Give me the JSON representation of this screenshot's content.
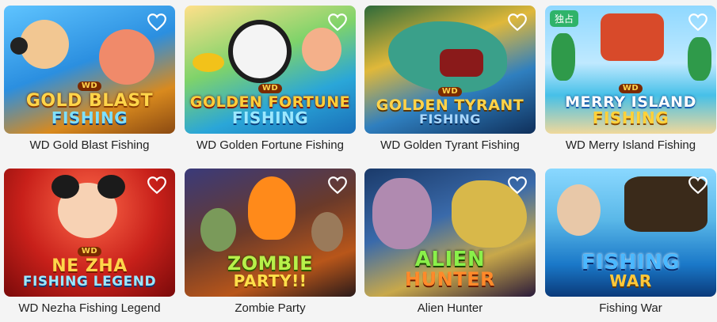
{
  "games": [
    {
      "title": "WD Gold Blast Fishing",
      "logo_line1": "GOLD BLAST",
      "logo_line2": "FISHING",
      "badge": "WD"
    },
    {
      "title": "WD Golden Fortune Fishing",
      "logo_line1": "GOLDEN FORTUNE",
      "logo_line2": "FISHING",
      "badge": "WD"
    },
    {
      "title": "WD Golden Tyrant Fishing",
      "logo_line1": "GOLDEN TYRANT",
      "logo_line2": "FISHING",
      "badge": "WD"
    },
    {
      "title": "WD Merry Island Fishing",
      "logo_line1": "MERRY ISLAND",
      "logo_line2": "FISHING",
      "badge": "WD",
      "tag": "独占"
    },
    {
      "title": "WD Nezha Fishing Legend",
      "logo_line1": "NE ZHA",
      "logo_line2": "FISHING LEGEND",
      "badge": "WD"
    },
    {
      "title": "Zombie Party",
      "logo_line1": "ZOMBIE",
      "logo_line2": "PARTY!!"
    },
    {
      "title": "Alien Hunter",
      "logo_line1": "ALIEN",
      "logo_line2": "HUNTER"
    },
    {
      "title": "Fishing War",
      "logo_line1": "FISHING",
      "logo_line2": "WAR"
    }
  ],
  "icons": {
    "favorite": "heart-outline-icon"
  }
}
